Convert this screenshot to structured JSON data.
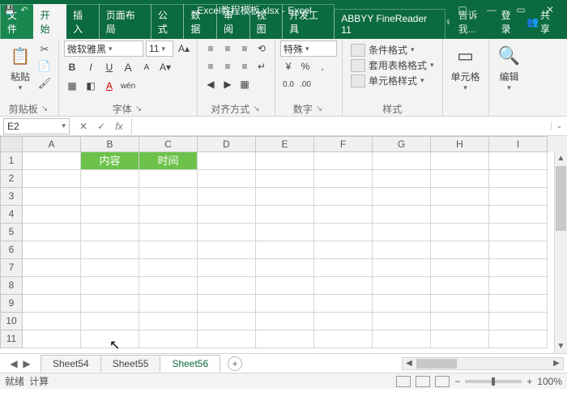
{
  "title": "Excel教程模板.xlsx - Excel",
  "qat": {
    "save": "💾",
    "undo": "↶",
    "redo": "↷",
    "more": "▾"
  },
  "win": {
    "min": "—",
    "max": "▭",
    "close": "✕",
    "ribmin": "▢"
  },
  "tabs": {
    "file": "文件",
    "home": "开始",
    "insert": "插入",
    "layout": "页面布局",
    "formula": "公式",
    "data": "数据",
    "review": "审阅",
    "view": "视图",
    "dev": "开发工具",
    "abbyy": "ABBYY FineReader 11"
  },
  "tellme_icon": "♀",
  "tellme": "告诉我...",
  "login": "登录",
  "share_icon": "👥",
  "share": "共享",
  "clipboard": {
    "label": "剪贴板",
    "paste": "粘贴",
    "paste_ico": "📋",
    "cut": "✂",
    "copy": "📄",
    "brush": "🖌"
  },
  "font": {
    "label": "字体",
    "name": "微软雅黑",
    "size": "11",
    "incr": "A▴",
    "decr": "A▾",
    "b": "B",
    "i": "I",
    "u": "U",
    "border": "▦",
    "fill": "◧",
    "color": "A",
    "wen": "wén"
  },
  "align": {
    "label": "对齐方式",
    "tl": "≡",
    "tc": "≡",
    "tr": "≡",
    "ml": "≡",
    "mc": "≡",
    "mr": "≡",
    "indL": "◀",
    "indR": "▶",
    "wrap": "↵",
    "merge": "▦"
  },
  "number": {
    "label": "数字",
    "fmt": "特殊",
    "cur": "¥",
    "pct": "%",
    "comma": ",",
    "dec1": "0.0",
    "dec2": ".00"
  },
  "styles": {
    "label": "样式",
    "cond": "条件格式",
    "table": "套用表格格式",
    "cell": "单元格样式",
    "ico1": "▦",
    "ico2": "▦",
    "ico3": "▦"
  },
  "cells": {
    "label": "单元格",
    "btn": "单元格",
    "ico": "▭"
  },
  "editing": {
    "label": "编辑",
    "btn": "编辑",
    "ico": "🔍"
  },
  "launcher": "↘",
  "namebox": "E2",
  "fx": {
    "cancel": "✕",
    "ok": "✓",
    "fx": "fx"
  },
  "cols": [
    "A",
    "B",
    "C",
    "D",
    "E",
    "F",
    "G",
    "H",
    "I"
  ],
  "rows": [
    "1",
    "2",
    "3",
    "4",
    "5",
    "6",
    "7",
    "8",
    "9",
    "10",
    "11"
  ],
  "headers": {
    "b1": "内容",
    "c1": "时间"
  },
  "sheets": {
    "s1": "Sheet54",
    "s2": "Sheet55",
    "s3": "Sheet56",
    "new": "+"
  },
  "status": {
    "ready": "就绪",
    "calc": "计算",
    "zoom": "100%",
    "minus": "−",
    "plus": "+"
  },
  "cursor": "↖"
}
